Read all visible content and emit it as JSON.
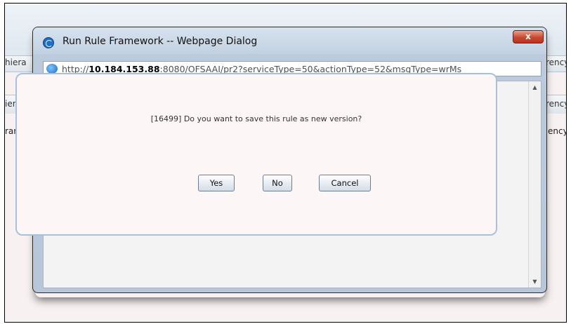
{
  "background": {
    "row1_left": "hiera",
    "row1_right": "rency",
    "row2_left": "iera...",
    "row2_right": "rency",
    "row3_left": "rarch",
    "row3_right": "ency"
  },
  "dialog": {
    "title": "Run Rule Framework -- Webpage Dialog",
    "close_label": "x",
    "url_prefix": "http://",
    "url_host": "10.184.153.88",
    "url_rest": ":8080/OFSAAI/pr2?serviceType=50&actionType=52&msgType=wrMs",
    "message": "[16499] Do you want to save this rule as new version?",
    "buttons": {
      "yes": "Yes",
      "no": "No",
      "cancel": "Cancel"
    }
  },
  "icons": {
    "title": "webpage-dialog-icon",
    "address": "internet-explorer-icon",
    "close": "close-icon",
    "scroll_up": "scroll-up-arrow-icon",
    "scroll_down": "scroll-down-arrow-icon"
  },
  "colors": {
    "close_button": "#c9492f",
    "dialog_frame": "#bccbdc",
    "message_panel_border": "#a9c0da"
  }
}
